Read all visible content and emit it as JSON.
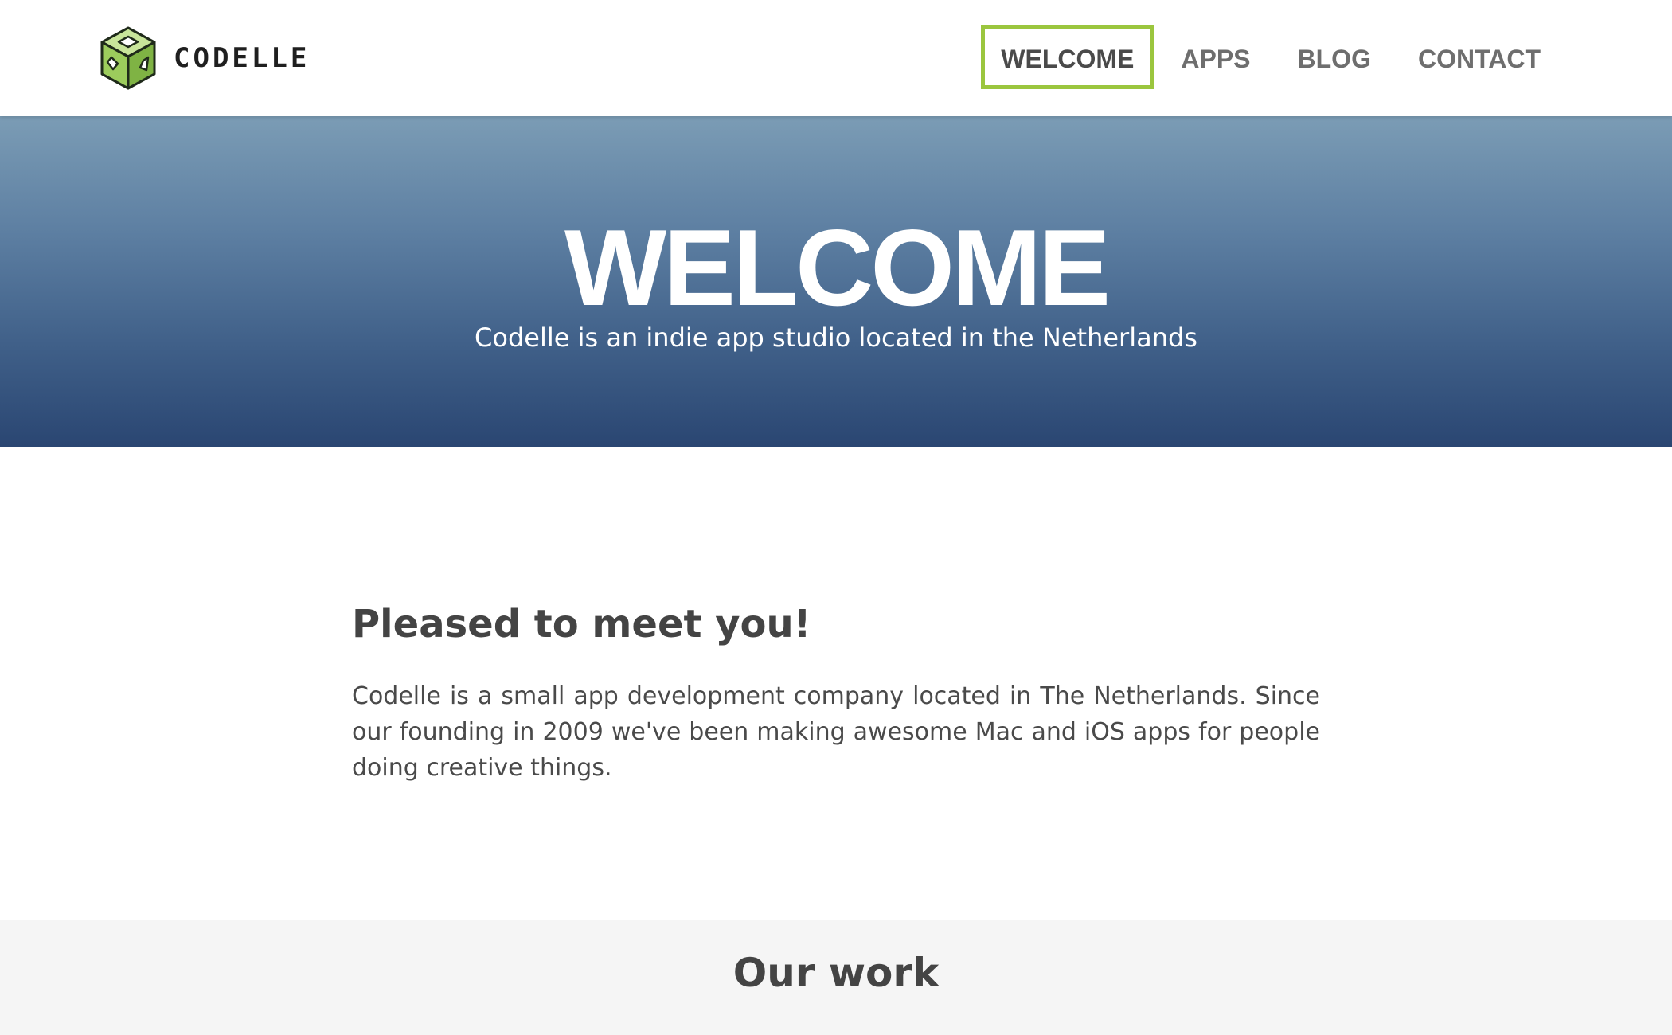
{
  "header": {
    "logo_text": "CODELLE",
    "nav": [
      {
        "label": "WELCOME",
        "active": true
      },
      {
        "label": "APPS",
        "active": false
      },
      {
        "label": "BLOG",
        "active": false
      },
      {
        "label": "CONTACT",
        "active": false
      }
    ]
  },
  "hero": {
    "title": "WELCOME",
    "subtitle": "Codelle is an indie app studio located in the Netherlands"
  },
  "intro": {
    "heading": "Pleased to meet you!",
    "body": "Codelle is a small app development company located in The Netherlands. Since our founding in 2009 we've been making awesome Mac and iOS apps for people doing creative things."
  },
  "work": {
    "heading": "Our work"
  },
  "colors": {
    "accent": "#9bc63e",
    "hero_top": "#7b9cb5",
    "hero_bottom": "#2a4672",
    "nav_text": "#6e6e6e",
    "heading_text": "#444444",
    "work_background": "#f5f5f5"
  },
  "icons": {
    "logo": "green-cube-icon"
  }
}
